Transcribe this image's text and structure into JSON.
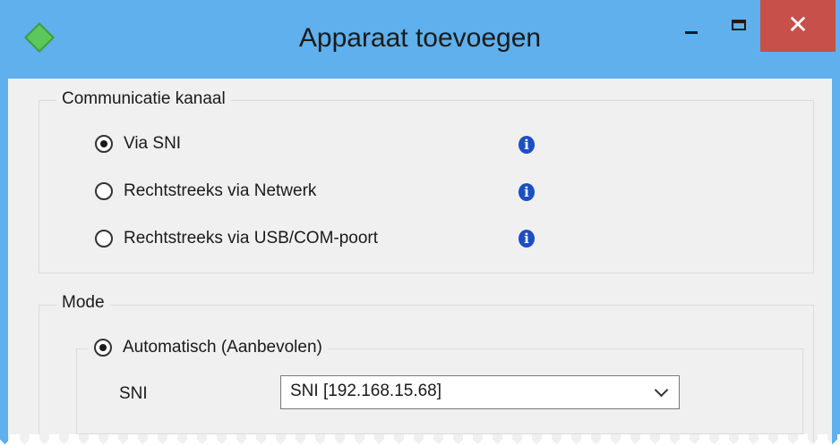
{
  "window": {
    "title": "Apparaat toevoegen",
    "close_glyph": "✕",
    "accent_color": "#5fb0ec",
    "close_color": "#c7504b"
  },
  "communication": {
    "group_label": "Communicatie kanaal",
    "options": [
      {
        "label": "Via SNI",
        "checked": true,
        "info_icon": "info-icon"
      },
      {
        "label": "Rechtstreeks via Netwerk",
        "checked": false,
        "info_icon": "info-icon"
      },
      {
        "label": "Rechtstreeks via USB/COM-poort",
        "checked": false,
        "info_icon": "info-icon"
      }
    ],
    "info_glyph": "i"
  },
  "mode": {
    "group_label": "Mode",
    "auto_option": {
      "label": "Automatisch (Aanbevolen)",
      "checked": true
    },
    "sni_label": "SNI",
    "sni_select_value": "SNI [192.168.15.68]"
  }
}
